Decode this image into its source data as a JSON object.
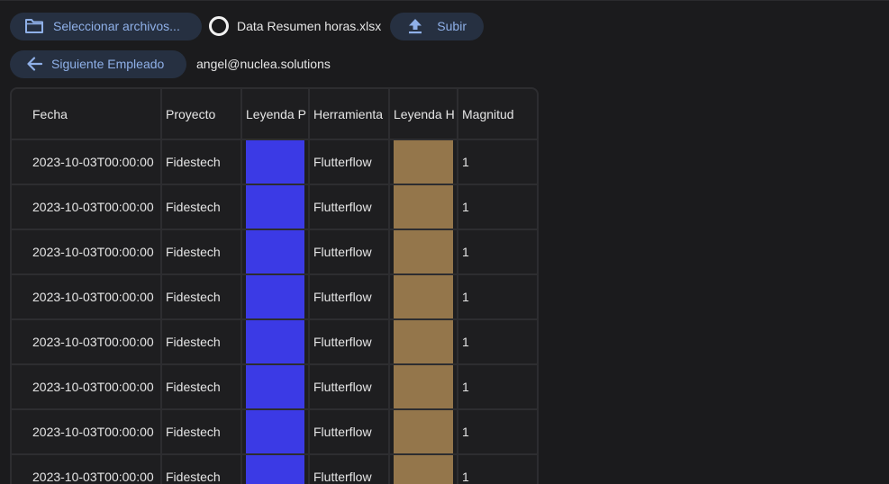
{
  "toolbar": {
    "select_label": "Seleccionar archivos...",
    "file_name": "Data Resumen horas.xlsx",
    "upload_label": "Subir",
    "next_label": "Siguiente Empleado",
    "user_email": "angel@nuclea.solutions"
  },
  "icons": {
    "select": "folder-icon",
    "status": "circle-outline-icon",
    "upload": "upload-icon",
    "next": "arrow-left-icon"
  },
  "colors": {
    "accent": "#8fb0e8",
    "button_bg": "#263041",
    "leyenda_p": "#3b3ae5",
    "leyenda_h": "#94764b"
  },
  "table": {
    "columns": [
      "Fecha",
      "Proyecto",
      "Leyenda P",
      "Herramienta",
      "Leyenda H",
      "Magnitud"
    ],
    "rows": [
      {
        "fecha": "2023-10-03T00:00:00",
        "proyecto": "Fidestech",
        "leyenda_p": "#3b3ae5",
        "herramienta": "Flutterflow",
        "leyenda_h": "#94764b",
        "magnitud": "1"
      },
      {
        "fecha": "2023-10-03T00:00:00",
        "proyecto": "Fidestech",
        "leyenda_p": "#3b3ae5",
        "herramienta": "Flutterflow",
        "leyenda_h": "#94764b",
        "magnitud": "1"
      },
      {
        "fecha": "2023-10-03T00:00:00",
        "proyecto": "Fidestech",
        "leyenda_p": "#3b3ae5",
        "herramienta": "Flutterflow",
        "leyenda_h": "#94764b",
        "magnitud": "1"
      },
      {
        "fecha": "2023-10-03T00:00:00",
        "proyecto": "Fidestech",
        "leyenda_p": "#3b3ae5",
        "herramienta": "Flutterflow",
        "leyenda_h": "#94764b",
        "magnitud": "1"
      },
      {
        "fecha": "2023-10-03T00:00:00",
        "proyecto": "Fidestech",
        "leyenda_p": "#3b3ae5",
        "herramienta": "Flutterflow",
        "leyenda_h": "#94764b",
        "magnitud": "1"
      },
      {
        "fecha": "2023-10-03T00:00:00",
        "proyecto": "Fidestech",
        "leyenda_p": "#3b3ae5",
        "herramienta": "Flutterflow",
        "leyenda_h": "#94764b",
        "magnitud": "1"
      },
      {
        "fecha": "2023-10-03T00:00:00",
        "proyecto": "Fidestech",
        "leyenda_p": "#3b3ae5",
        "herramienta": "Flutterflow",
        "leyenda_h": "#94764b",
        "magnitud": "1"
      },
      {
        "fecha": "2023-10-03T00:00:00",
        "proyecto": "Fidestech",
        "leyenda_p": "#3b3ae5",
        "herramienta": "Flutterflow",
        "leyenda_h": "#94764b",
        "magnitud": "1"
      }
    ]
  }
}
